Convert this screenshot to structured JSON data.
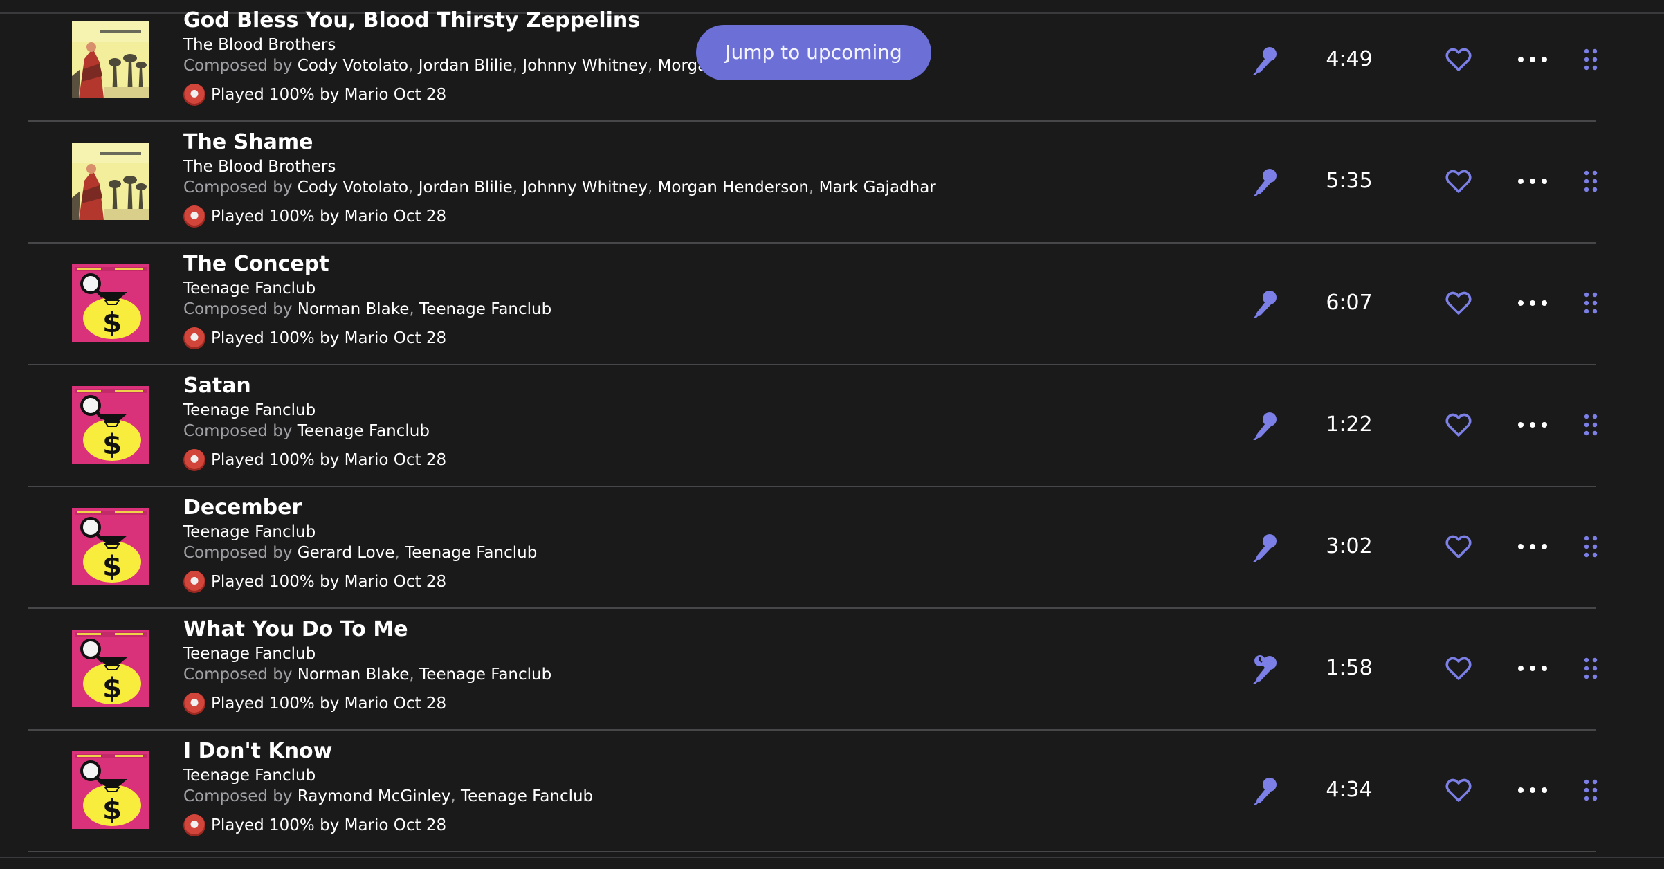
{
  "jump_button": {
    "label": "Jump to upcoming"
  },
  "accent_color": "#7b7fe6",
  "composed_label": "Composed by",
  "tracks": [
    {
      "title": "God Bless You, Blood Thirsty Zeppelins",
      "artist": "The Blood Brothers",
      "composers": [
        "Cody Votolato",
        "Jordan Blilie",
        "Johnny Whitney",
        "Morgan He"
      ],
      "played": "Played 100% by Mario Oct 28",
      "duration": "4:49",
      "art": "blood-brothers"
    },
    {
      "title": "The Shame",
      "artist": "The Blood Brothers",
      "composers": [
        "Cody Votolato",
        "Jordan Blilie",
        "Johnny Whitney",
        "Morgan Henderson",
        "Mark Gajadhar"
      ],
      "played": "Played 100% by Mario Oct 28",
      "duration": "5:35",
      "art": "blood-brothers"
    },
    {
      "title": "The Concept",
      "artist": "Teenage Fanclub",
      "composers": [
        "Norman Blake",
        "Teenage Fanclub"
      ],
      "played": "Played 100% by Mario Oct 28",
      "duration": "6:07",
      "art": "bandwagonesque"
    },
    {
      "title": "Satan",
      "artist": "Teenage Fanclub",
      "composers": [
        "Teenage Fanclub"
      ],
      "played": "Played 100% by Mario Oct 28",
      "duration": "1:22",
      "art": "bandwagonesque"
    },
    {
      "title": "December",
      "artist": "Teenage Fanclub",
      "composers": [
        "Gerard Love",
        "Teenage Fanclub"
      ],
      "played": "Played 100% by Mario Oct 28",
      "duration": "3:02",
      "art": "bandwagonesque"
    },
    {
      "title": "What You Do To Me",
      "artist": "Teenage Fanclub",
      "composers": [
        "Norman Blake",
        "Teenage Fanclub"
      ],
      "played": "Played 100% by Mario Oct 28",
      "duration": "1:58",
      "art": "bandwagonesque",
      "mic_icon": "lyrics-pending-icon"
    },
    {
      "title": "I Don't Know",
      "artist": "Teenage Fanclub",
      "composers": [
        "Raymond McGinley",
        "Teenage Fanclub"
      ],
      "played": "Played 100% by Mario Oct 28",
      "duration": "4:34",
      "art": "bandwagonesque"
    }
  ]
}
